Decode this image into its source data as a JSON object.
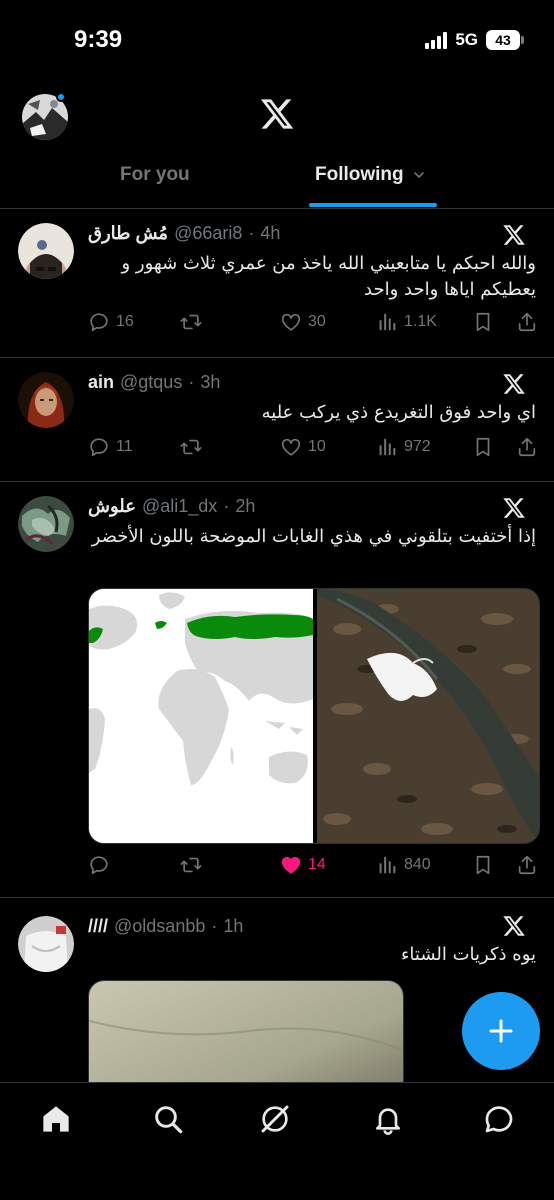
{
  "status_bar": {
    "time": "9:39",
    "network": "5G",
    "battery": "43"
  },
  "header": {
    "logo": "x-logo-icon",
    "tabs": [
      {
        "label": "For you",
        "active": false
      },
      {
        "label": "Following",
        "active": true
      }
    ]
  },
  "posts": [
    {
      "name": "مُش طارق",
      "handle": "@66ari8",
      "time": "4h",
      "text": "والله احبكم يا متابعيني الله ياخذ من عمري ثلاث شهور و يعطيكم اياها واحد واحد",
      "replies": "16",
      "likes": "30",
      "views": "1.1K"
    },
    {
      "name": "ain",
      "handle": "@gtqus",
      "time": "3h",
      "text": "اي واحد فوق التغريدع ذي يركب عليه",
      "replies": "11",
      "likes": "10",
      "views": "972"
    },
    {
      "name": "علوش",
      "handle": "@ali1_dx",
      "time": "2h",
      "text": "إذا أختفيت بتلقوني في هذي الغابات الموضحة باللون الأخضر",
      "replies": "",
      "likes": "14",
      "liked": true,
      "views": "840"
    },
    {
      "name": "////",
      "handle": "@oldsanbb",
      "time": "1h",
      "text": "يوه ذكريات الشتاء"
    }
  ],
  "fab": {
    "icon": "plus-icon"
  },
  "bottom_nav": [
    "home-icon",
    "search-icon",
    "grok-icon",
    "notifications-icon",
    "messages-icon"
  ],
  "colors": {
    "accent": "#1d9bf0",
    "like": "#f91880",
    "muted": "#71767b",
    "map_green": "#0a8a0a"
  }
}
